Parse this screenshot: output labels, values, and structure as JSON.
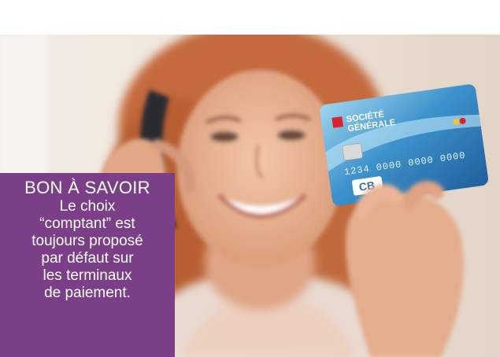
{
  "image": {
    "subject": "photo",
    "colors": {
      "panel_background": "#7a3f86",
      "panel_text": "#ffffff",
      "card_blue": "#3d8fc9",
      "card_logo_red": "#d9232e",
      "hair": "#c0663a",
      "skin": "#e8b495"
    }
  },
  "info_box": {
    "title": "BON À SAVOIR",
    "lines": [
      "Le choix",
      "“comptant” est",
      "toujours proposé",
      "par défaut sur",
      "les terminaux",
      "de paiement."
    ]
  },
  "card": {
    "bank_name_line1": "SOCIÉTÉ",
    "bank_name_line2": "GÉNÉRALE",
    "number": "1234 0000 0000 0000",
    "network_mark": "CB"
  }
}
